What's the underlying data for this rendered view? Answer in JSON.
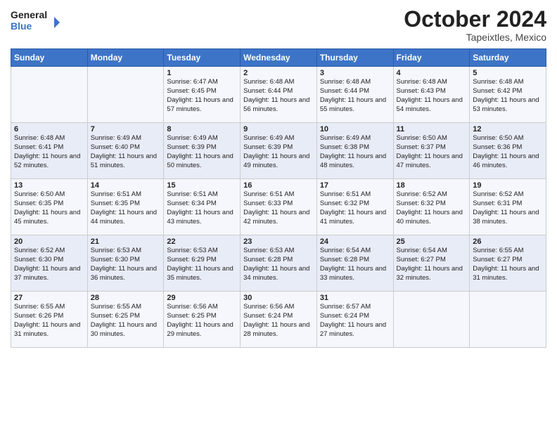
{
  "header": {
    "logo_line1": "General",
    "logo_line2": "Blue",
    "month": "October 2024",
    "location": "Tapeixtles, Mexico"
  },
  "weekdays": [
    "Sunday",
    "Monday",
    "Tuesday",
    "Wednesday",
    "Thursday",
    "Friday",
    "Saturday"
  ],
  "weeks": [
    [
      {
        "day": "",
        "info": ""
      },
      {
        "day": "",
        "info": ""
      },
      {
        "day": "1",
        "info": "Sunrise: 6:47 AM\nSunset: 6:45 PM\nDaylight: 11 hours and 57 minutes."
      },
      {
        "day": "2",
        "info": "Sunrise: 6:48 AM\nSunset: 6:44 PM\nDaylight: 11 hours and 56 minutes."
      },
      {
        "day": "3",
        "info": "Sunrise: 6:48 AM\nSunset: 6:44 PM\nDaylight: 11 hours and 55 minutes."
      },
      {
        "day": "4",
        "info": "Sunrise: 6:48 AM\nSunset: 6:43 PM\nDaylight: 11 hours and 54 minutes."
      },
      {
        "day": "5",
        "info": "Sunrise: 6:48 AM\nSunset: 6:42 PM\nDaylight: 11 hours and 53 minutes."
      }
    ],
    [
      {
        "day": "6",
        "info": "Sunrise: 6:48 AM\nSunset: 6:41 PM\nDaylight: 11 hours and 52 minutes."
      },
      {
        "day": "7",
        "info": "Sunrise: 6:49 AM\nSunset: 6:40 PM\nDaylight: 11 hours and 51 minutes."
      },
      {
        "day": "8",
        "info": "Sunrise: 6:49 AM\nSunset: 6:39 PM\nDaylight: 11 hours and 50 minutes."
      },
      {
        "day": "9",
        "info": "Sunrise: 6:49 AM\nSunset: 6:39 PM\nDaylight: 11 hours and 49 minutes."
      },
      {
        "day": "10",
        "info": "Sunrise: 6:49 AM\nSunset: 6:38 PM\nDaylight: 11 hours and 48 minutes."
      },
      {
        "day": "11",
        "info": "Sunrise: 6:50 AM\nSunset: 6:37 PM\nDaylight: 11 hours and 47 minutes."
      },
      {
        "day": "12",
        "info": "Sunrise: 6:50 AM\nSunset: 6:36 PM\nDaylight: 11 hours and 46 minutes."
      }
    ],
    [
      {
        "day": "13",
        "info": "Sunrise: 6:50 AM\nSunset: 6:35 PM\nDaylight: 11 hours and 45 minutes."
      },
      {
        "day": "14",
        "info": "Sunrise: 6:51 AM\nSunset: 6:35 PM\nDaylight: 11 hours and 44 minutes."
      },
      {
        "day": "15",
        "info": "Sunrise: 6:51 AM\nSunset: 6:34 PM\nDaylight: 11 hours and 43 minutes."
      },
      {
        "day": "16",
        "info": "Sunrise: 6:51 AM\nSunset: 6:33 PM\nDaylight: 11 hours and 42 minutes."
      },
      {
        "day": "17",
        "info": "Sunrise: 6:51 AM\nSunset: 6:32 PM\nDaylight: 11 hours and 41 minutes."
      },
      {
        "day": "18",
        "info": "Sunrise: 6:52 AM\nSunset: 6:32 PM\nDaylight: 11 hours and 40 minutes."
      },
      {
        "day": "19",
        "info": "Sunrise: 6:52 AM\nSunset: 6:31 PM\nDaylight: 11 hours and 38 minutes."
      }
    ],
    [
      {
        "day": "20",
        "info": "Sunrise: 6:52 AM\nSunset: 6:30 PM\nDaylight: 11 hours and 37 minutes."
      },
      {
        "day": "21",
        "info": "Sunrise: 6:53 AM\nSunset: 6:30 PM\nDaylight: 11 hours and 36 minutes."
      },
      {
        "day": "22",
        "info": "Sunrise: 6:53 AM\nSunset: 6:29 PM\nDaylight: 11 hours and 35 minutes."
      },
      {
        "day": "23",
        "info": "Sunrise: 6:53 AM\nSunset: 6:28 PM\nDaylight: 11 hours and 34 minutes."
      },
      {
        "day": "24",
        "info": "Sunrise: 6:54 AM\nSunset: 6:28 PM\nDaylight: 11 hours and 33 minutes."
      },
      {
        "day": "25",
        "info": "Sunrise: 6:54 AM\nSunset: 6:27 PM\nDaylight: 11 hours and 32 minutes."
      },
      {
        "day": "26",
        "info": "Sunrise: 6:55 AM\nSunset: 6:27 PM\nDaylight: 11 hours and 31 minutes."
      }
    ],
    [
      {
        "day": "27",
        "info": "Sunrise: 6:55 AM\nSunset: 6:26 PM\nDaylight: 11 hours and 31 minutes."
      },
      {
        "day": "28",
        "info": "Sunrise: 6:55 AM\nSunset: 6:25 PM\nDaylight: 11 hours and 30 minutes."
      },
      {
        "day": "29",
        "info": "Sunrise: 6:56 AM\nSunset: 6:25 PM\nDaylight: 11 hours and 29 minutes."
      },
      {
        "day": "30",
        "info": "Sunrise: 6:56 AM\nSunset: 6:24 PM\nDaylight: 11 hours and 28 minutes."
      },
      {
        "day": "31",
        "info": "Sunrise: 6:57 AM\nSunset: 6:24 PM\nDaylight: 11 hours and 27 minutes."
      },
      {
        "day": "",
        "info": ""
      },
      {
        "day": "",
        "info": ""
      }
    ]
  ]
}
